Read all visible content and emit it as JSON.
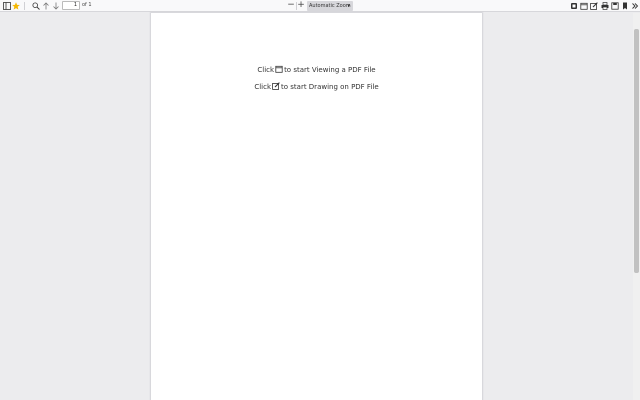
{
  "toolbar": {
    "page_number": "1",
    "page_count_label": "of 1",
    "zoom_value": "Automatic Zoom",
    "zoom_out_label": "−",
    "zoom_in_label": "+"
  },
  "document": {
    "line1_prefix": "Click",
    "line1_suffix": "to start Viewing a PDF File",
    "line2_prefix": "Click",
    "line2_suffix": "to start Drawing on PDF File"
  },
  "colors": {
    "background": "#ececee",
    "toolbar": "#f9f9fa",
    "bookmark_star": "#f5b700"
  },
  "icons": [
    "sidebar-toggle-icon",
    "star-icon",
    "search-icon",
    "arrow-up-icon",
    "arrow-down-icon",
    "open-file-icon",
    "draw-icon",
    "presentation-icon",
    "print-icon",
    "save-icon",
    "bookmark-icon",
    "tools-icon"
  ]
}
